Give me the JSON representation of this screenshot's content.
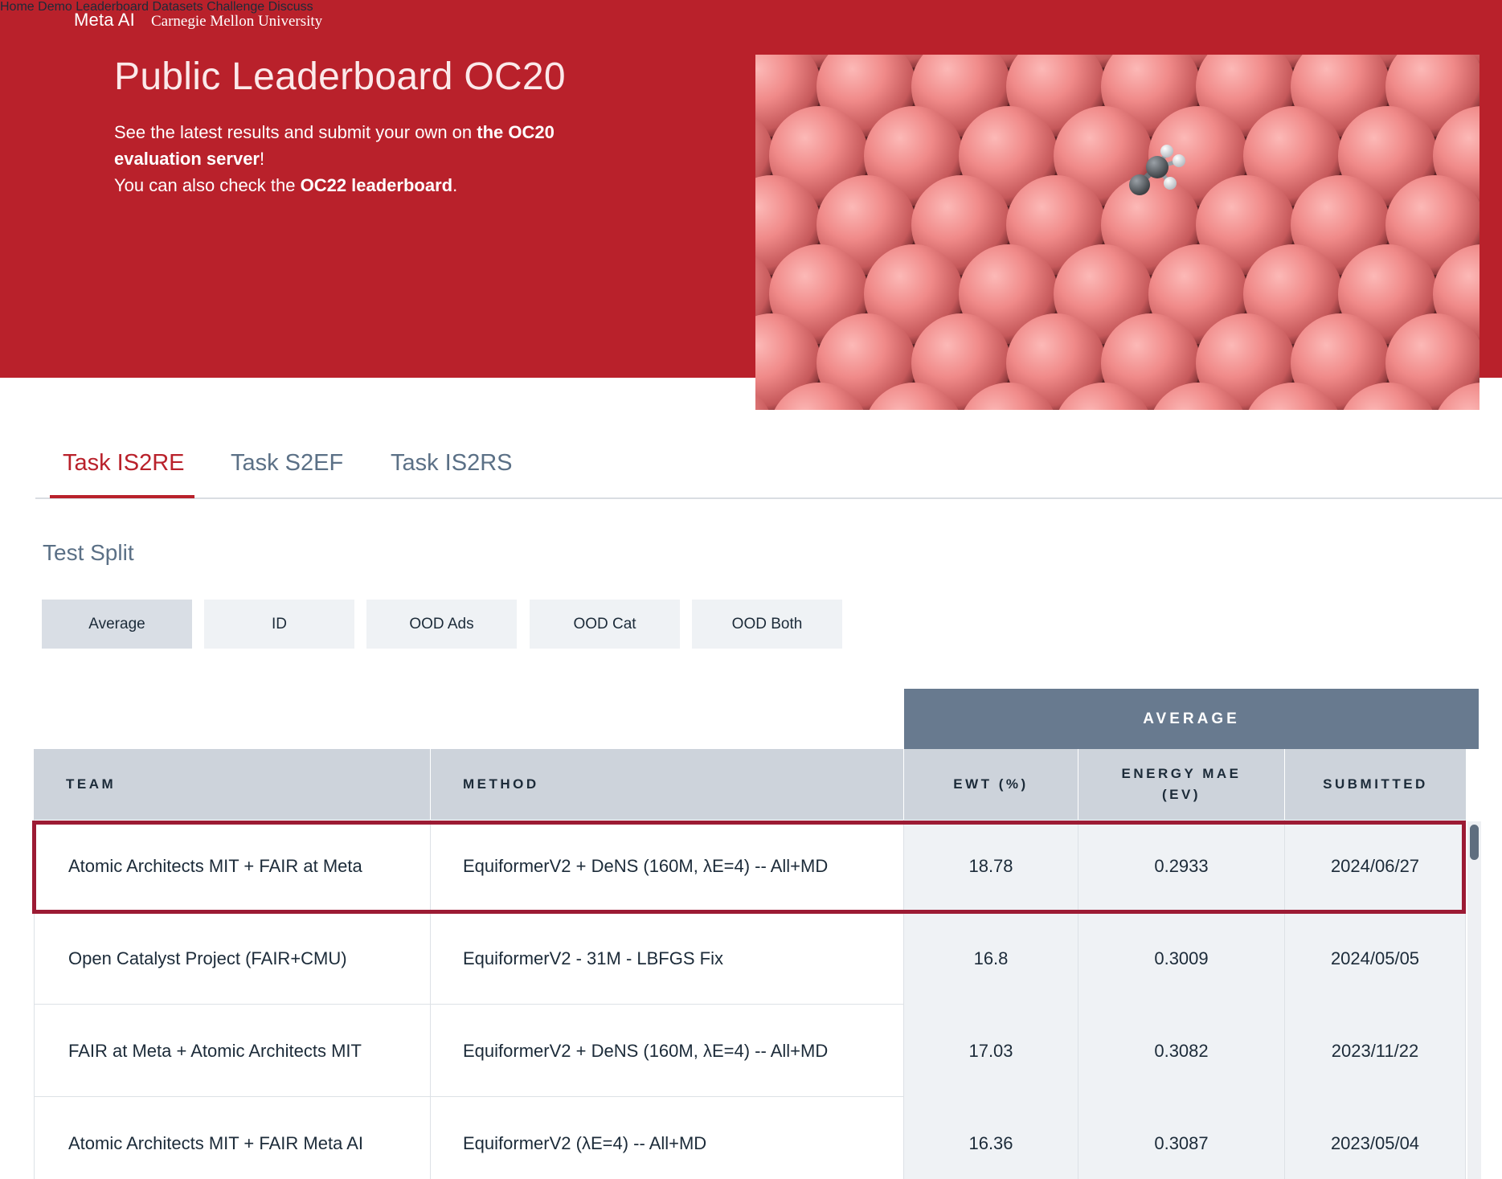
{
  "brand": {
    "meta": "Meta AI",
    "cmu": "Carnegie Mellon University"
  },
  "nav": [
    "Home",
    "Demo",
    "Leaderboard",
    "Datasets",
    "Challenge",
    "Discuss"
  ],
  "hero": {
    "title": "Public Leaderboard OC20",
    "line1_pre": "See the latest results and submit your own on ",
    "line1_bold": "the OC20 evaluation server",
    "line1_post": "!",
    "line2_pre": "You can also check the ",
    "line2_bold": "OC22 leaderboard",
    "line2_post": "."
  },
  "tabs": [
    "Task IS2RE",
    "Task S2EF",
    "Task IS2RS"
  ],
  "split": {
    "label": "Test Split",
    "options": [
      "Average",
      "ID",
      "OOD Ads",
      "OOD Cat",
      "OOD Both"
    ]
  },
  "table": {
    "group_header": "AVERAGE",
    "columns": {
      "team": "TEAM",
      "method": "METHOD",
      "ewt": "EWT (%)",
      "energy_1": "ENERGY MAE",
      "energy_2": "(EV)",
      "submitted": "SUBMITTED"
    },
    "rows": [
      {
        "team": "Atomic Architects MIT + FAIR at Meta",
        "method": "EquiformerV2 + DeNS (160M, λE=4) -- All+MD",
        "ewt": "18.78",
        "energy": "0.2933",
        "submitted": "2024/06/27"
      },
      {
        "team": "Open Catalyst Project (FAIR+CMU)",
        "method": "EquiformerV2 - 31M - LBFGS Fix",
        "ewt": "16.8",
        "energy": "0.3009",
        "submitted": "2024/05/05"
      },
      {
        "team": "FAIR at Meta + Atomic Architects MIT",
        "method": "EquiformerV2 + DeNS (160M, λE=4) -- All+MD",
        "ewt": "17.03",
        "energy": "0.3082",
        "submitted": "2023/11/22"
      },
      {
        "team": "Atomic Architects MIT + FAIR Meta AI",
        "method": "EquiformerV2 (λE=4) -- All+MD",
        "ewt": "16.36",
        "energy": "0.3087",
        "submitted": "2023/05/04"
      }
    ]
  },
  "colors": {
    "primary_red": "#b9212b",
    "slate": "#687a8f",
    "highlight": "#9c1b34"
  }
}
